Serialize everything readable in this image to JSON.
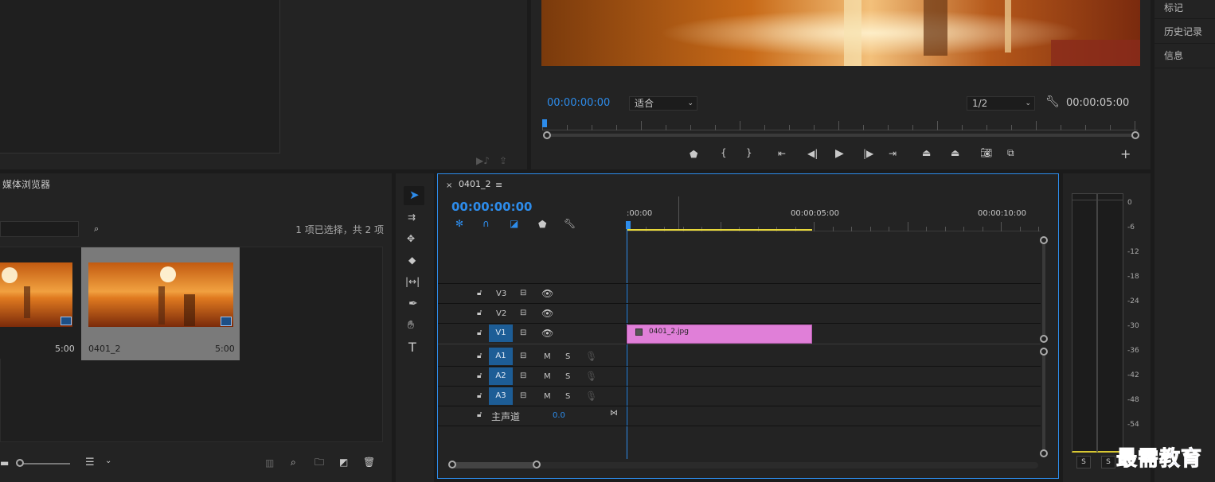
{
  "right_panel": {
    "items": [
      "标记",
      "历史记录",
      "信息"
    ]
  },
  "program_monitor": {
    "timecode_left": "00:00:00:00",
    "fit_select": "适合",
    "resolution_select": "1/2",
    "timecode_right": "00:00:05:00"
  },
  "project_panel": {
    "tab_label": "媒体浏览器",
    "selection_info": "1 项已选择，共 2 项",
    "items": [
      {
        "name": "",
        "duration": "5:00"
      },
      {
        "name": "0401_2",
        "duration": "5:00"
      }
    ]
  },
  "timeline": {
    "sequence_name": "0401_2",
    "timecode": "00:00:00:00",
    "ruler_labels": [
      ":00:00",
      "00:00:05:00",
      "00:00:10:00"
    ],
    "video_tracks": [
      "V3",
      "V2",
      "V1"
    ],
    "audio_tracks": [
      "A1",
      "A2",
      "A3"
    ],
    "mute_label": "M",
    "solo_label": "S",
    "master_label": "主声道",
    "master_value": "0.0",
    "clip_name": "0401_2.jpg"
  },
  "audio_meter": {
    "scale": [
      "0",
      "-6",
      "-12",
      "-18",
      "-24",
      "-30",
      "-36",
      "-42",
      "-48",
      "-54"
    ],
    "solo_labels": [
      "S",
      "S"
    ]
  },
  "watermark": "最需教育",
  "colors": {
    "accent_blue": "#2d8ceb",
    "clip_pink": "#e07fd8",
    "work_area_yellow": "#e8d83a",
    "track_target_blue": "#1d5d96"
  }
}
